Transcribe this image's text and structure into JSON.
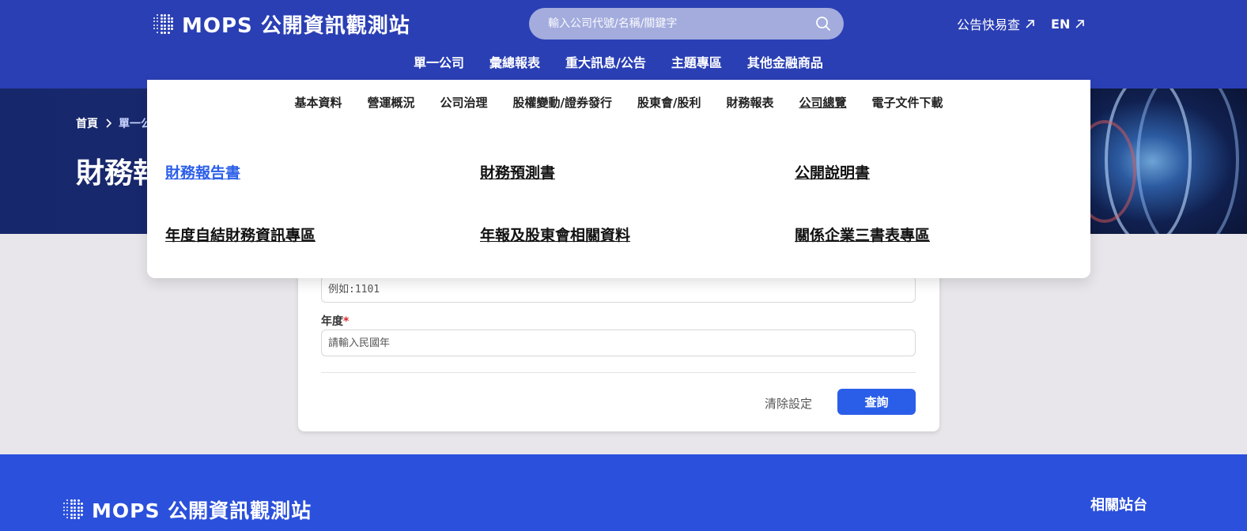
{
  "header": {
    "logo_text": "MOPS 公開資訊觀測站",
    "search_placeholder": "輸入公司代號/名稱/關鍵字",
    "links": [
      {
        "label": "公告快易查"
      },
      {
        "label": "EN"
      }
    ],
    "nav": [
      {
        "label": "單一公司",
        "active": true
      },
      {
        "label": "彙總報表"
      },
      {
        "label": "重大訊息/公告"
      },
      {
        "label": "主題專區"
      },
      {
        "label": "其他金融商品"
      }
    ]
  },
  "hero": {
    "breadcrumb": [
      "首頁",
      "單一公"
    ],
    "title": "財務報"
  },
  "mega_menu": {
    "sub_nav": [
      {
        "label": "基本資料"
      },
      {
        "label": "營運概況"
      },
      {
        "label": "公司治理"
      },
      {
        "label": "股權變動/證券發行"
      },
      {
        "label": "股東會/股利"
      },
      {
        "label": "財務報表"
      },
      {
        "label": "公司總覽",
        "underlined": true
      },
      {
        "label": "電子文件下載"
      }
    ],
    "links": [
      {
        "label": "財務報告書",
        "active": true
      },
      {
        "label": "財務預測書"
      },
      {
        "label": "公開說明書"
      },
      {
        "label": "年度自結財務資訊專區"
      },
      {
        "label": "年報及股東會相關資料"
      },
      {
        "label": "關係企業三書表專區"
      }
    ]
  },
  "form": {
    "company_placeholder": "例如:1101",
    "year_label": "年度",
    "year_required_mark": "*",
    "year_placeholder": "請輸入民國年",
    "clear_label": "清除設定",
    "query_label": "查詢"
  },
  "footer": {
    "logo_text": "MOPS 公開資訊觀測站",
    "related_label": "相關站台"
  },
  "colors": {
    "header_bg": "#2a3fb4",
    "hero_bg": "#17276b",
    "accent": "#2b5ee8",
    "footer_bg": "#2b50dc",
    "required": "#e02424"
  }
}
